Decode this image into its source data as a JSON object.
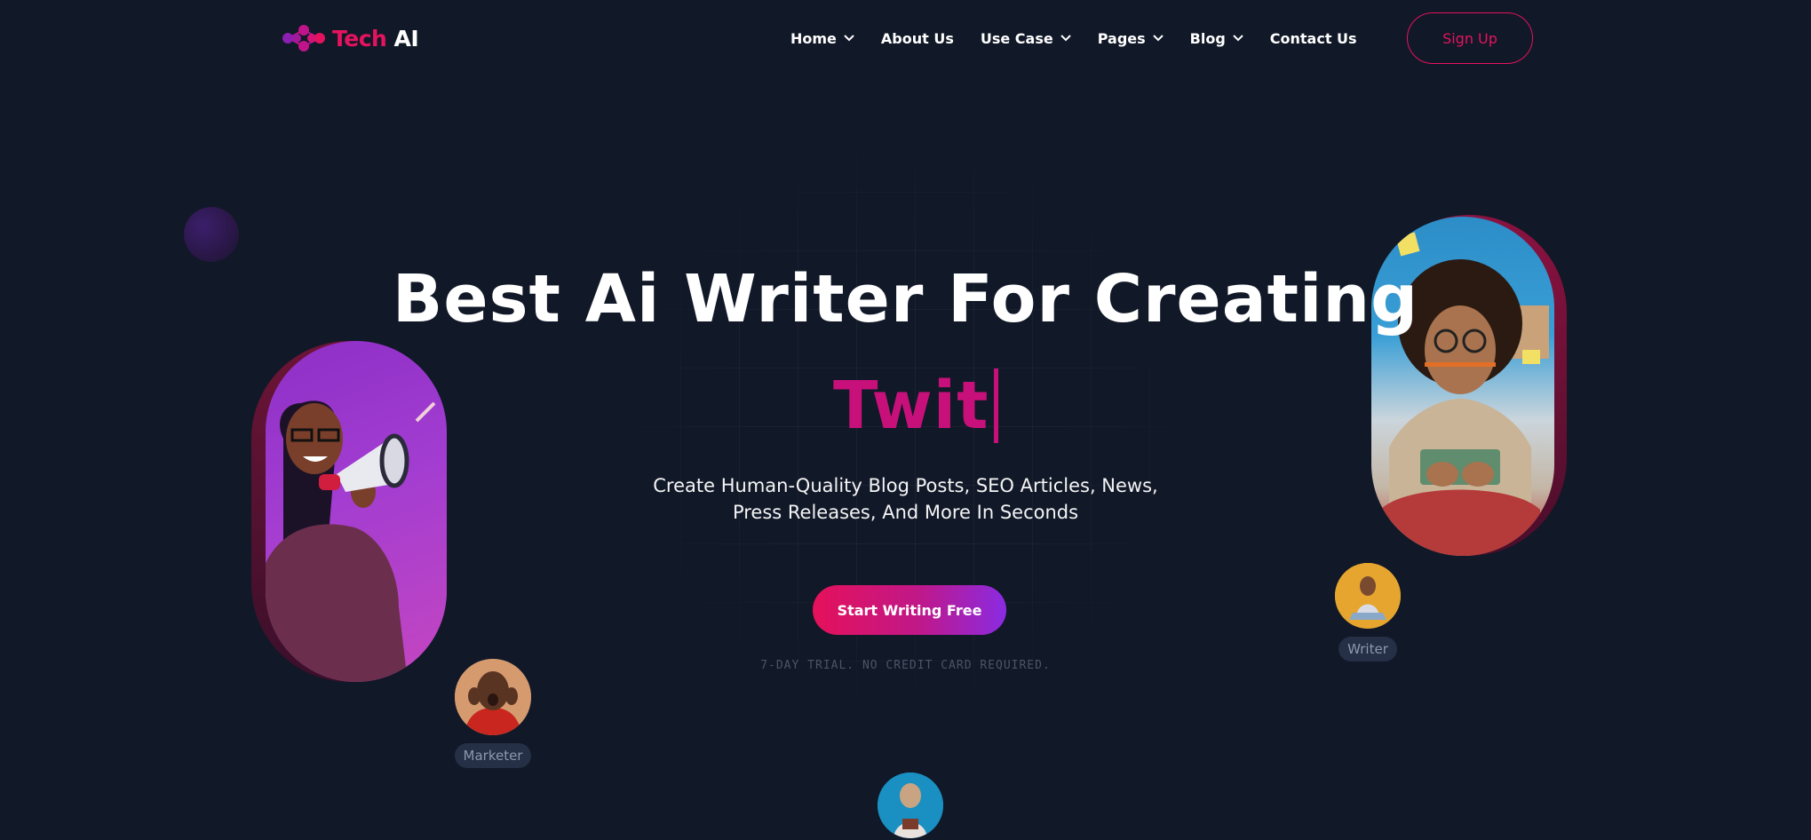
{
  "brand": {
    "name_part1": "Tech",
    "name_part2": "AI",
    "accent": "#e5135f",
    "icon": "dots-network-logo-icon"
  },
  "nav": {
    "items": [
      {
        "label": "Home",
        "has_dropdown": true
      },
      {
        "label": "About Us",
        "has_dropdown": false
      },
      {
        "label": "Use Case",
        "has_dropdown": true
      },
      {
        "label": "Pages",
        "has_dropdown": true
      },
      {
        "label": "Blog",
        "has_dropdown": true
      },
      {
        "label": "Contact Us",
        "has_dropdown": false
      }
    ],
    "signup_label": "Sign Up"
  },
  "hero": {
    "title": "Best Ai Writer For Creating",
    "typed_text": "Twit",
    "subtitle_line1": "Create Human-Quality Blog Posts, SEO Articles, News,",
    "subtitle_line2": "Press Releases, And More In Seconds",
    "cta_label": "Start Writing Free",
    "trial_note": "7-DAY TRIAL. NO CREDIT CARD REQUIRED."
  },
  "roles": {
    "marketer": "Marketer",
    "writer": "Writer"
  },
  "colors": {
    "background": "#111827",
    "accent_pink": "#e5135f",
    "typed_magenta": "#c8107a",
    "cta_gradient_end": "#8a2be2",
    "tag_bg": "#253047"
  }
}
